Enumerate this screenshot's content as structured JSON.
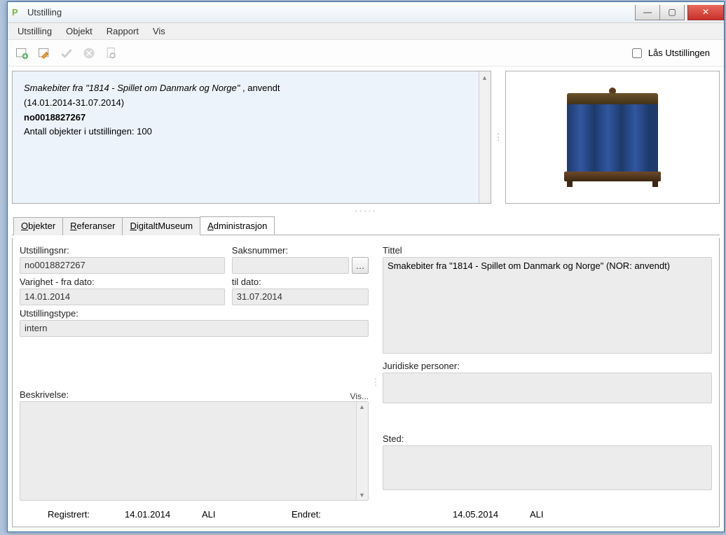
{
  "window": {
    "title": "Utstilling"
  },
  "menu": {
    "utstilling": "Utstilling",
    "objekt": "Objekt",
    "rapport": "Rapport",
    "vis": "Vis"
  },
  "toolbar": {
    "lock_label": "Lås Utstillingen"
  },
  "info": {
    "title": "Smakebiter fra \"1814 - Spillet om Danmark og Norge\"",
    "title_suffix": " ,  anvendt",
    "dates": "(14.01.2014-31.07.2014)",
    "id": "no0018827267",
    "count": "Antall objekter i utstillingen: 100"
  },
  "tabs": {
    "objekter": "Objekter",
    "referanser": "Referanser",
    "digitalt": "DigitaltMuseum",
    "admin": "Administrasjon"
  },
  "form": {
    "utstillingsnr_label": "Utstillingsnr:",
    "utstillingsnr_value": "no0018827267",
    "saksnummer_label": "Saksnummer:",
    "saksnummer_value": "",
    "varighet_fra_label": "Varighet - fra dato:",
    "varighet_fra_value": "14.01.2014",
    "til_dato_label": "til dato:",
    "til_dato_value": "31.07.2014",
    "utstillingstype_label": "Utstillingstype:",
    "utstillingstype_value": "intern",
    "beskrivelse_label": "Beskrivelse:",
    "vis_label": "Vis...",
    "tittel_label": "Tittel",
    "tittel_value": "Smakebiter fra \"1814 - Spillet om Danmark og Norge\" (NOR: anvendt)",
    "juridiske_label": "Juridiske personer:",
    "sted_label": "Sted:"
  },
  "footer": {
    "registrert_label": "Registrert:",
    "registrert_date": "14.01.2014",
    "registrert_user": "ALI",
    "endret_label": "Endret:",
    "endret_date": "14.05.2014",
    "endret_user": "ALI"
  }
}
